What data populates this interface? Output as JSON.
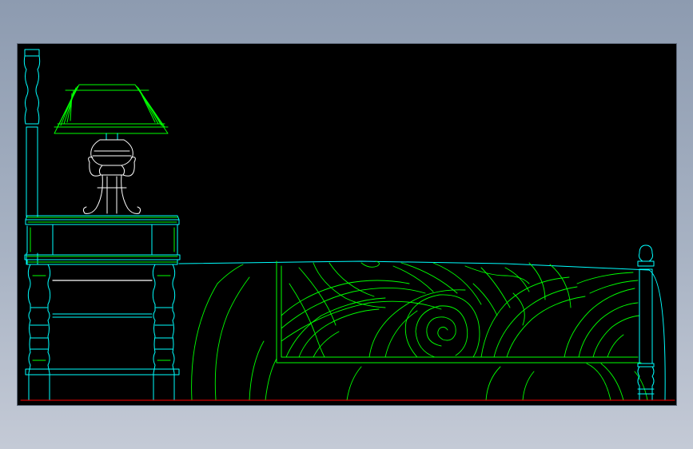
{
  "canvas": {
    "background": "#000000",
    "window_background": "#98a5b8"
  },
  "colors": {
    "cyan": "#00ffff",
    "green": "#00ff00",
    "white": "#ffffff",
    "red": "#ff0000"
  },
  "drawing": {
    "subject": "bed-and-nightstand-elevation",
    "parts": [
      "bedpost-left",
      "table-lamp",
      "nightstand",
      "mattress",
      "bed-frame-panel",
      "bedpost-right",
      "floor-line"
    ]
  }
}
